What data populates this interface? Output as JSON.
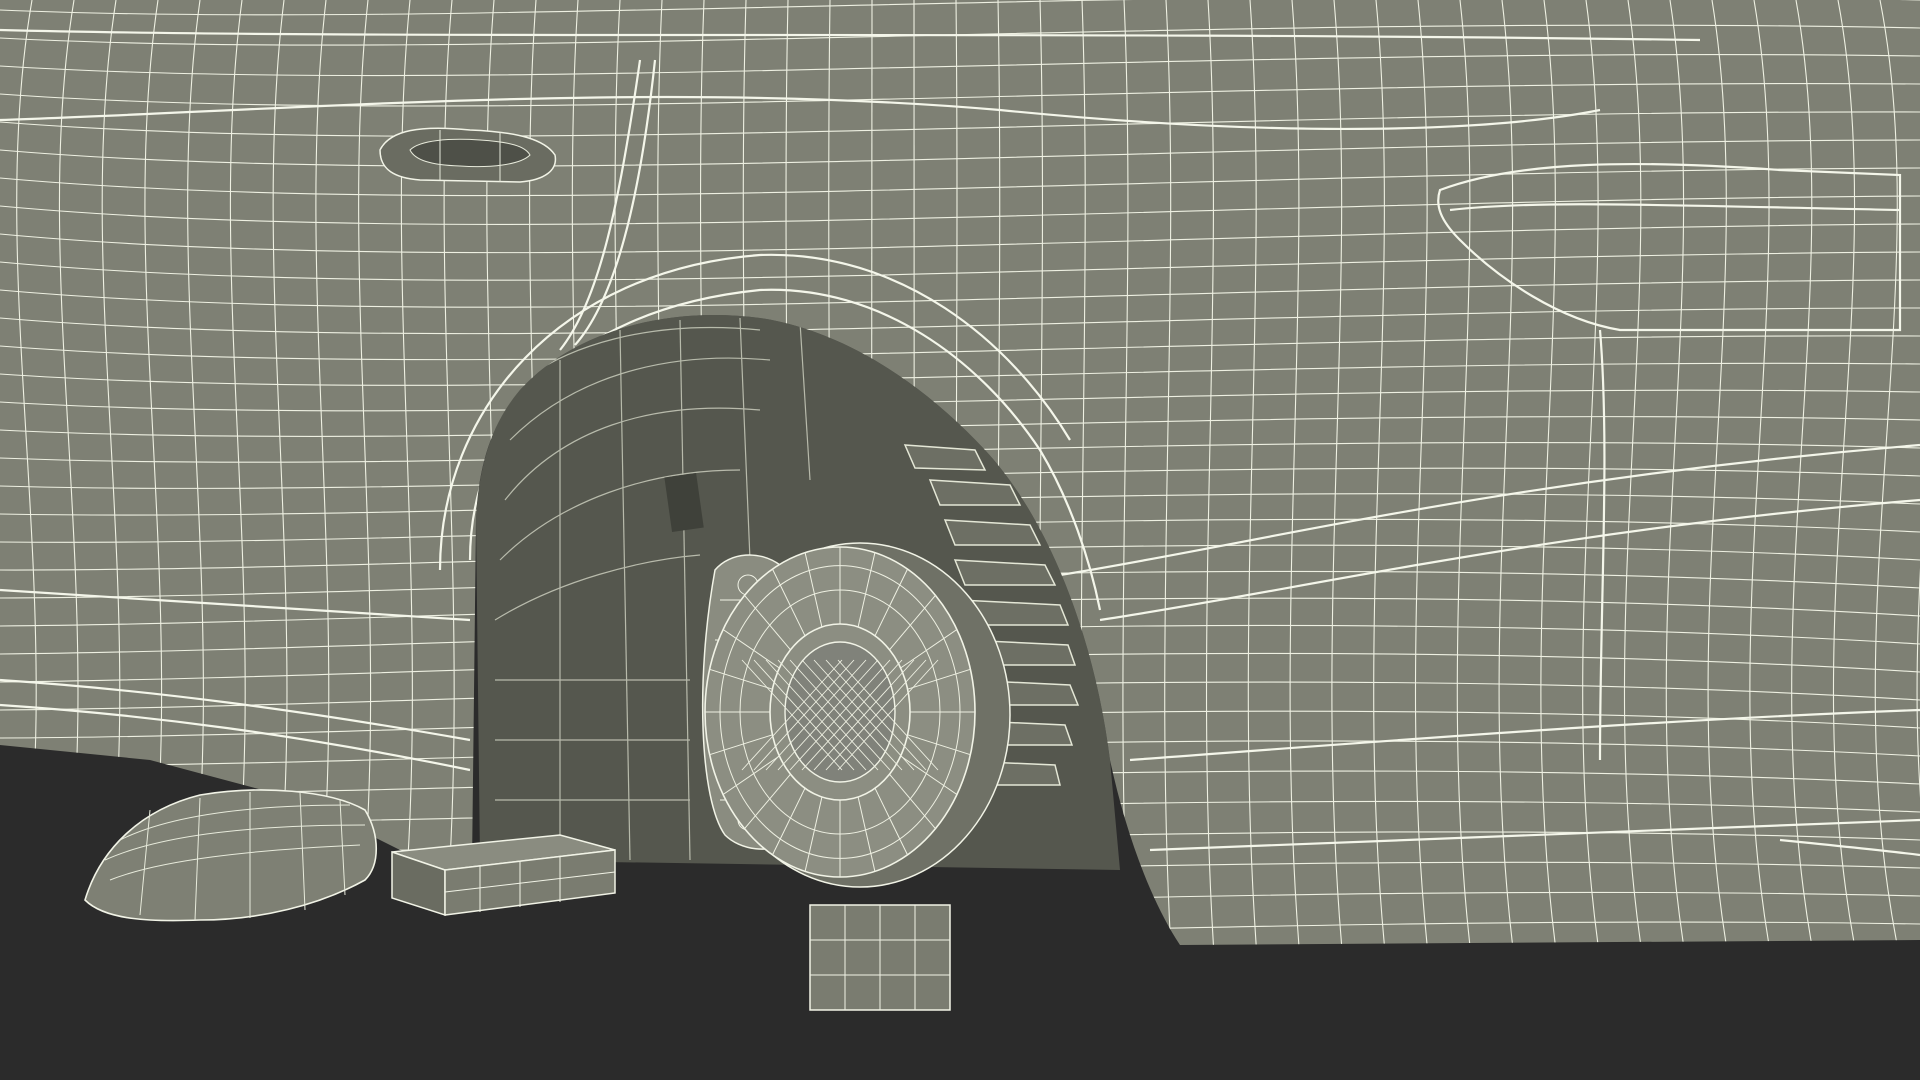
{
  "scene": {
    "subject": "car-front-wheel-wireframe",
    "colors": {
      "background": "#2b2b2b",
      "body": "#7f8175",
      "body_light": "#8a8c80",
      "wheel_well": "#5b5d53",
      "wheel_well_dark": "#4a4c43",
      "wire": "#e9ecdc",
      "shadow": "#3a3b34"
    },
    "parts": [
      "car-body",
      "front-fender",
      "wheel-arch",
      "headlight",
      "front-bumper",
      "side-skirt",
      "door-handle",
      "side-mirror",
      "brake-disc",
      "brake-caliper",
      "coil-spring",
      "support-block-left",
      "support-block-center"
    ]
  }
}
